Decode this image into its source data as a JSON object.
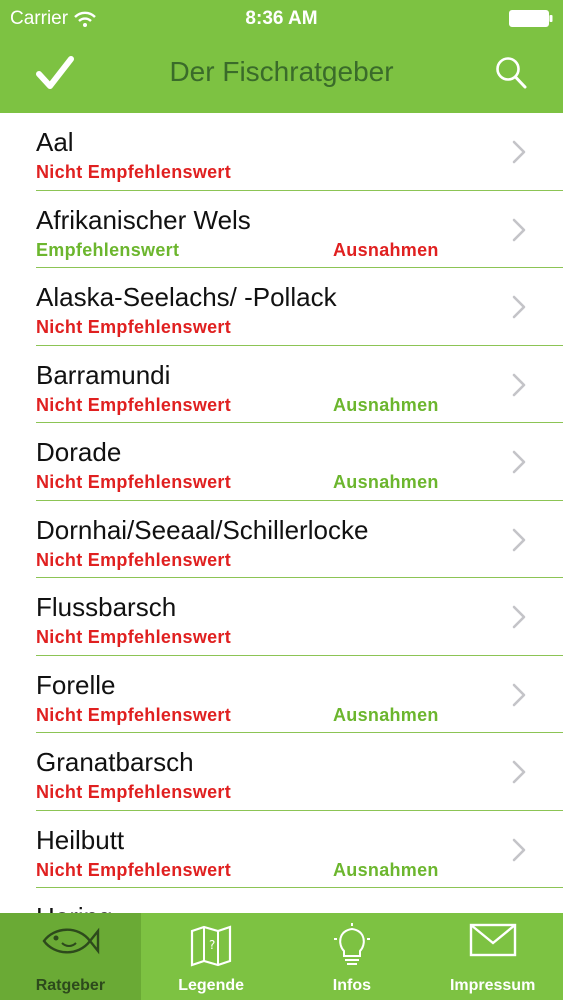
{
  "status_bar": {
    "carrier": "Carrier",
    "time": "8:36 AM"
  },
  "nav": {
    "title": "Der Fischratgeber"
  },
  "colors": {
    "accent": "#7dc242",
    "not_recommended": "#e02020",
    "recommended": "#6cb62e"
  },
  "list": {
    "items": [
      {
        "name": "Aal",
        "status": "Nicht Empfehlenswert",
        "status_type": "bad",
        "exception": "",
        "exception_type": ""
      },
      {
        "name": "Afrikanischer Wels",
        "status": "Empfehlenswert",
        "status_type": "good",
        "exception": "Ausnahmen",
        "exception_type": "bad"
      },
      {
        "name": "Alaska-Seelachs/ -Pollack",
        "status": "Nicht Empfehlenswert",
        "status_type": "bad",
        "exception": "",
        "exception_type": ""
      },
      {
        "name": "Barramundi",
        "status": "Nicht Empfehlenswert",
        "status_type": "bad",
        "exception": "Ausnahmen",
        "exception_type": "good"
      },
      {
        "name": "Dorade",
        "status": "Nicht Empfehlenswert",
        "status_type": "bad",
        "exception": "Ausnahmen",
        "exception_type": "good"
      },
      {
        "name": "Dornhai/Seeaal/Schillerlocke",
        "status": "Nicht Empfehlenswert",
        "status_type": "bad",
        "exception": "",
        "exception_type": ""
      },
      {
        "name": "Flussbarsch",
        "status": "Nicht Empfehlenswert",
        "status_type": "bad",
        "exception": "",
        "exception_type": ""
      },
      {
        "name": "Forelle",
        "status": "Nicht Empfehlenswert",
        "status_type": "bad",
        "exception": "Ausnahmen",
        "exception_type": "good"
      },
      {
        "name": "Granatbarsch",
        "status": "Nicht Empfehlenswert",
        "status_type": "bad",
        "exception": "",
        "exception_type": ""
      },
      {
        "name": "Heilbutt",
        "status": "Nicht Empfehlenswert",
        "status_type": "bad",
        "exception": "Ausnahmen",
        "exception_type": "good"
      },
      {
        "name": "Hering",
        "status": "",
        "status_type": "bad",
        "exception": "",
        "exception_type": ""
      }
    ]
  },
  "tabbar": {
    "tabs": [
      {
        "label": "Ratgeber",
        "icon": "fish-icon",
        "active": true
      },
      {
        "label": "Legende",
        "icon": "map-icon",
        "active": false
      },
      {
        "label": "Infos",
        "icon": "lightbulb-icon",
        "active": false
      },
      {
        "label": "Impressum",
        "icon": "envelope-icon",
        "active": false
      }
    ]
  }
}
